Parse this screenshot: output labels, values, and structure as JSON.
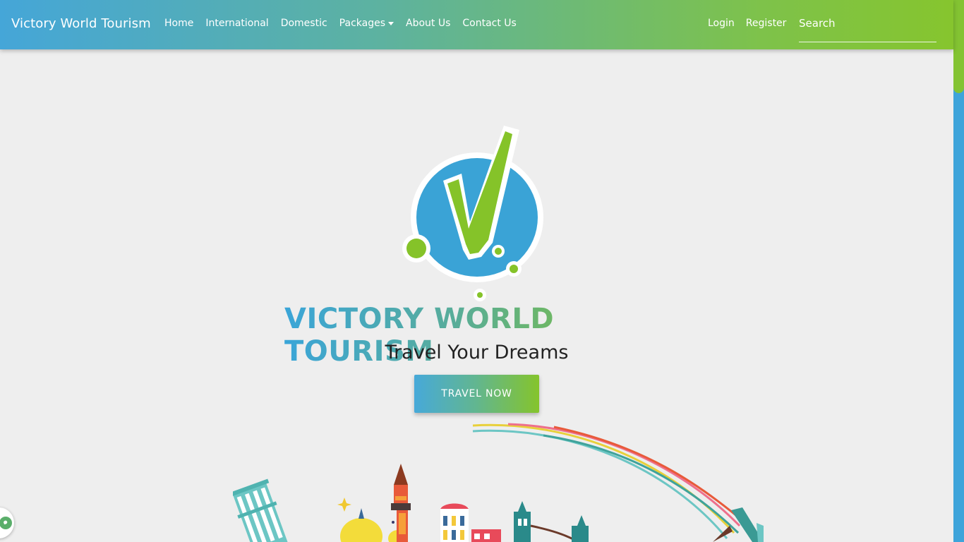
{
  "brand": "Victory World Tourism",
  "nav": {
    "links": [
      "Home",
      "International",
      "Domestic",
      "Packages",
      "About Us",
      "Contact Us"
    ],
    "right": [
      "Login",
      "Register"
    ],
    "search_placeholder": "Search"
  },
  "hero": {
    "title": "VICTORY WORLD TOURISM",
    "subtitle": "Travel Your Dreams",
    "cta": "TRAVEL NOW"
  },
  "colors": {
    "brand_blue": "#3aa5d8",
    "brand_green": "#85c329",
    "background": "#eeeeee"
  },
  "icons": [
    "logo-check-icon",
    "caret-down-icon",
    "chat-icon"
  ]
}
